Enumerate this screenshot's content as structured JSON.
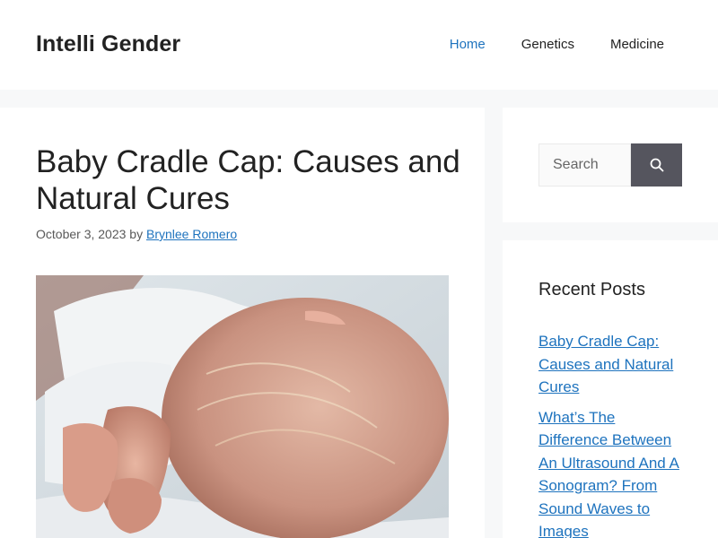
{
  "site": {
    "title": "Intelli Gender"
  },
  "nav": {
    "items": [
      {
        "label": "Home",
        "active": true
      },
      {
        "label": "Genetics",
        "active": false
      },
      {
        "label": "Medicine",
        "active": false
      }
    ]
  },
  "post": {
    "title": "Baby Cradle Cap: Causes and Natural Cures",
    "date": "October 3, 2023",
    "by": "by",
    "author": "Brynlee Romero"
  },
  "search": {
    "placeholder": "Search",
    "button_icon": "search-icon"
  },
  "recent_posts": {
    "title": "Recent Posts",
    "items": [
      "Baby Cradle Cap: Causes and Natural Cures",
      "What’s The Difference Between An Ultrasound And A Sonogram? From Sound Waves to Images"
    ]
  },
  "colors": {
    "accent": "#1e73be",
    "search_button": "#55555e",
    "page_bg": "#f7f8f9"
  }
}
